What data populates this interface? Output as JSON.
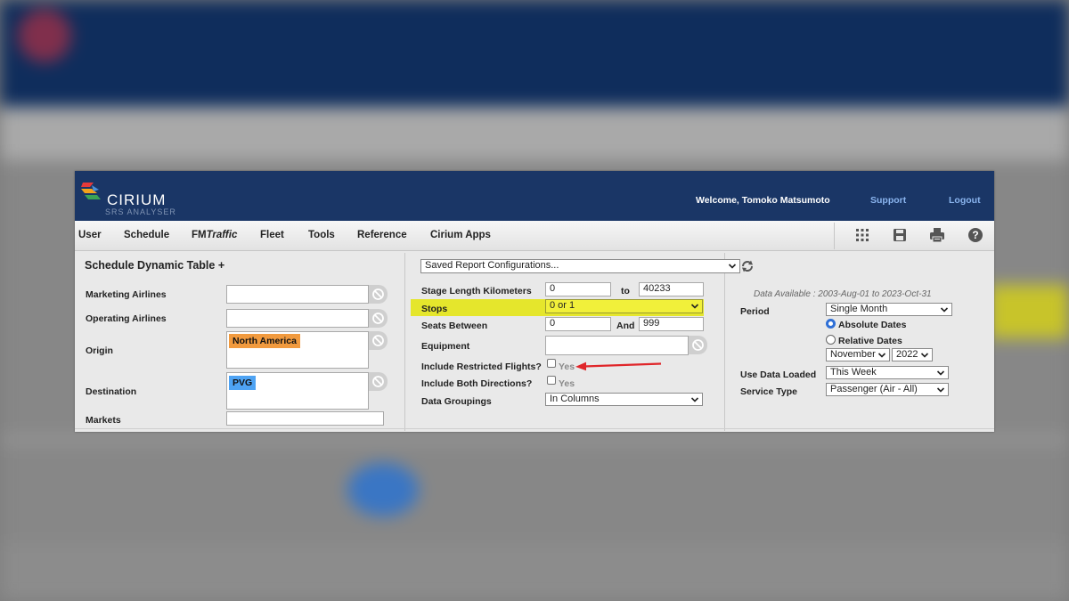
{
  "app": {
    "brand": "CIRIUM",
    "brand_sub": "SRS ANALYSER",
    "welcome": "Welcome, Tomoko Matsumoto",
    "support_link": "Support",
    "logout_link": "Logout"
  },
  "menu": {
    "items": [
      "User",
      "Schedule",
      "FM",
      "Traffic",
      "Fleet",
      "Tools",
      "Reference",
      "Cirium Apps"
    ],
    "tool_icons": [
      "apps-grid-icon",
      "save-icon",
      "print-icon",
      "help-icon"
    ]
  },
  "left": {
    "title": "Schedule Dynamic Table +",
    "marketing_airlines": "Marketing Airlines",
    "operating_airlines": "Operating Airlines",
    "origin": "Origin",
    "origin_tag": "North America",
    "destination": "Destination",
    "destination_tag": "PVG",
    "markets": "Markets"
  },
  "middle": {
    "saved_config": "Saved Report Configurations...",
    "stage_length_label": "Stage Length Kilometers",
    "stage_from": "0",
    "stage_to_label": "to",
    "stage_to": "40233",
    "stops_label": "Stops",
    "stops_value": "0 or 1",
    "seats_label": "Seats Between",
    "seats_from": "0",
    "seats_and_label": "And",
    "seats_to": "999",
    "equipment_label": "Equipment",
    "restricted_label": "Include Restricted Flights?",
    "restricted_yes": "Yes",
    "both_dir_label": "Include Both Directions?",
    "both_dir_yes": "Yes",
    "groupings_label": "Data Groupings",
    "groupings_value": "In Columns"
  },
  "right": {
    "data_available": "Data Available :  2003-Aug-01 to 2023-Oct-31",
    "period_label": "Period",
    "period_value": "Single Month",
    "absolute_dates": "Absolute Dates",
    "relative_dates": "Relative Dates",
    "month_value": "November",
    "year_value": "2022",
    "use_data_label": "Use Data Loaded",
    "use_data_value": "This Week",
    "service_type_label": "Service Type",
    "service_type_value": "Passenger (Air - All)"
  },
  "colors": {
    "header": "#1a3666",
    "highlight": "#e5e62c",
    "origin_tag": "#f19a3e",
    "destination_tag": "#4ea3f3",
    "arrow": "#e0262a"
  }
}
